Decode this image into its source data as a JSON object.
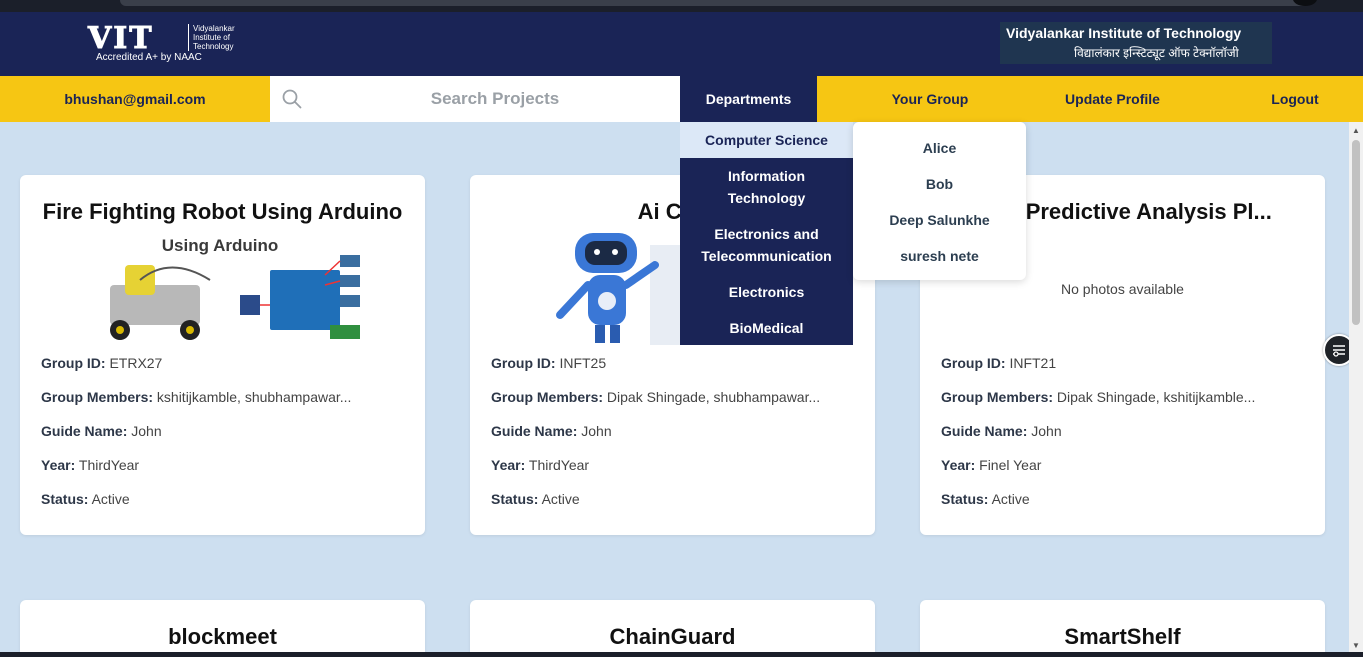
{
  "header": {
    "logo": {
      "text": "VIT",
      "tag_lines": [
        "Vidyalankar",
        "Institute of",
        "Technology"
      ],
      "accreditation": "Accredited A+ by NAAC"
    },
    "institute_name_en": "Vidyalankar Institute of Technology",
    "institute_name_hi": "विद्यालंकार इन्स्टिट्यूट ऑफ टेक्नॉलॉजी"
  },
  "nav": {
    "email": "bhushan@gmail.com",
    "search_placeholder": "Search Projects",
    "departments": "Departments",
    "your_group": "Your Group",
    "update_profile": "Update Profile",
    "logout": "Logout"
  },
  "departments_menu": {
    "items": [
      {
        "label": "Computer Science",
        "active": true
      },
      {
        "label": "Information Technology",
        "line1": "Information",
        "line2": "Technology"
      },
      {
        "label": "Electronics and Telecommunication",
        "line1": "Electronics and",
        "line2": "Telecommunication"
      },
      {
        "label": "Electronics"
      },
      {
        "label": "BioMedical"
      }
    ]
  },
  "group_menu": {
    "members": [
      "Alice",
      "Bob",
      "Deep Salunkhe",
      "suresh nete"
    ]
  },
  "labels": {
    "group_id": "Group ID:",
    "group_members": "Group Members:",
    "guide_name": "Guide Name:",
    "year": "Year:",
    "status": "Status:"
  },
  "projects": [
    {
      "title": "Fire Fighting Robot Using Arduino",
      "image_caption": "Using Arduino",
      "group_id": "ETRX27",
      "group_members": "kshitijkamble, shubhampawar...",
      "guide_name": "John",
      "year": "ThirdYear",
      "status": "Active"
    },
    {
      "title": "Ai Cha",
      "group_id": "INFT25",
      "group_members": "Dipak Shingade, shubhampawar...",
      "guide_name": "John",
      "year": "ThirdYear",
      "status": "Active"
    },
    {
      "title": "ered Predictive Analysis Pl...",
      "no_photos": "No photos available",
      "group_id": "INFT21",
      "group_members": "Dipak Shingade, kshitijkamble...",
      "guide_name": "John",
      "year": "Finel Year",
      "status": "Active"
    },
    {
      "title": "blockmeet"
    },
    {
      "title": "ChainGuard"
    },
    {
      "title": "SmartShelf"
    }
  ],
  "colors": {
    "navy": "#1a2456",
    "yellow": "#f6c613",
    "page_bg": "#cddff0"
  }
}
